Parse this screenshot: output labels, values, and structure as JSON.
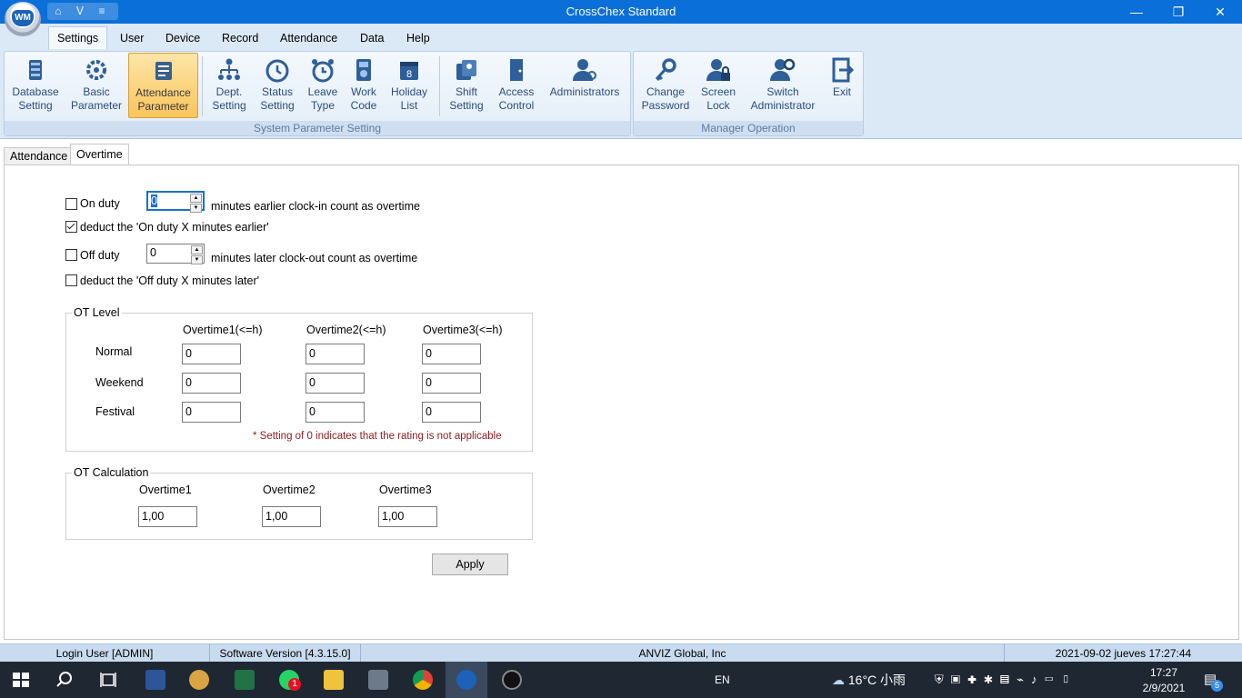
{
  "window": {
    "title": "CrossChex Standard",
    "minimize_glyph": "—",
    "restore_glyph": "❐",
    "close_glyph": "✕"
  },
  "quick_access": {
    "icons": [
      "home-icon",
      "user-icon",
      "dropdown-icon"
    ],
    "glyphs": [
      "⌂",
      "Ⅴ",
      "≡"
    ]
  },
  "logo": {
    "text": "WM"
  },
  "menu": [
    "Settings",
    "User",
    "Device",
    "Record",
    "Attendance",
    "Data",
    "Help"
  ],
  "ribbon": {
    "groups": [
      {
        "label": "System Parameter Setting"
      },
      {
        "label": "Manager Operation"
      }
    ],
    "buttons": [
      {
        "line1": "Database",
        "line2": "Setting",
        "icon": "database-icon"
      },
      {
        "line1": "Basic",
        "line2": "Parameter",
        "icon": "gear-icon"
      },
      {
        "line1": "Attendance",
        "line2": "Parameter",
        "icon": "attendance-parameter-icon"
      },
      {
        "line1": "Dept.",
        "line2": "Setting",
        "icon": "org-chart-icon"
      },
      {
        "line1": "Status",
        "line2": "Setting",
        "icon": "clock-icon"
      },
      {
        "line1": "Leave",
        "line2": "Type",
        "icon": "alarm-clock-icon"
      },
      {
        "line1": "Work",
        "line2": "Code",
        "icon": "work-code-icon"
      },
      {
        "line1": "Holiday",
        "line2": "List",
        "icon": "calendar-icon"
      },
      {
        "line1": "Shift",
        "line2": "Setting",
        "icon": "shift-icon"
      },
      {
        "line1": "Access",
        "line2": "Control",
        "icon": "door-icon"
      },
      {
        "line1": "Administrators",
        "line2": "",
        "icon": "admin-icon"
      },
      {
        "line1": "Change",
        "line2": "Password",
        "icon": "key-icon"
      },
      {
        "line1": "Screen",
        "line2": "Lock",
        "icon": "lock-icon"
      },
      {
        "line1": "Switch",
        "line2": "Administrator",
        "icon": "switch-admin-icon"
      },
      {
        "line1": "Exit",
        "line2": "",
        "icon": "exit-icon"
      }
    ]
  },
  "tabs": [
    "Attendance",
    "Overtime"
  ],
  "overtime": {
    "on_duty": {
      "checked": false,
      "label": "On duty",
      "value": "0",
      "suffix": "minutes earlier clock-in count as overtime"
    },
    "deduct_on": {
      "checked": true,
      "label": "deduct the 'On duty X minutes earlier'"
    },
    "off_duty": {
      "checked": false,
      "label": "Off duty",
      "value": "0",
      "suffix": "minutes later clock-out count as overtime"
    },
    "deduct_off": {
      "checked": false,
      "label": "deduct the 'Off duty X minutes later'"
    },
    "ot_level": {
      "legend": "OT Level",
      "columns": [
        "Overtime1(<=h)",
        "Overtime2(<=h)",
        "Overtime3(<=h)"
      ],
      "rows": [
        {
          "label": "Normal",
          "values": [
            "0",
            "0",
            "0"
          ]
        },
        {
          "label": "Weekend",
          "values": [
            "0",
            "0",
            "0"
          ]
        },
        {
          "label": "Festival",
          "values": [
            "0",
            "0",
            "0"
          ]
        }
      ],
      "note": "* Setting of 0 indicates that the rating is not applicable",
      "note_color": "#8b1a1a"
    },
    "ot_calc": {
      "legend": "OT Calculation",
      "columns": [
        "Overtime1",
        "Overtime2",
        "Overtime3"
      ],
      "values": [
        "1,00",
        "1,00",
        "1,00"
      ]
    },
    "apply_label": "Apply"
  },
  "status": {
    "login": "Login User [ADMIN]",
    "version": "Software Version [4.3.15.0]",
    "company": "ANVIZ Global, Inc",
    "datetime": "2021-09-02 jueves 17:27:44"
  },
  "taskbar": {
    "apps": [
      "windows-start-icon",
      "search-icon",
      "task-view-icon",
      "word-icon",
      "paint-icon",
      "excel-icon",
      "whatsapp-icon",
      "file-explorer-icon",
      "calculator-icon",
      "chrome-icon",
      "crosschex-icon",
      "camera-icon"
    ],
    "whatsapp_badge": "1",
    "lang": "EN",
    "weather": "16°C 小雨",
    "time": "17:27",
    "date": "2/9/2021",
    "notifications": "5"
  }
}
